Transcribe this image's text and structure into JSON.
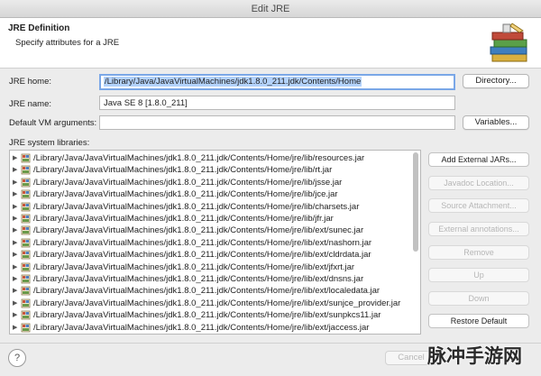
{
  "window": {
    "title": "Edit JRE"
  },
  "header": {
    "title": "JRE Definition",
    "description": "Specify attributes for a JRE",
    "banner_icon": "books-banner-icon"
  },
  "form": {
    "jre_home_label": "JRE home:",
    "jre_home_value": "/Library/Java/JavaVirtualMachines/jdk1.8.0_211.jdk/Contents/Home",
    "directory_button": "Directory...",
    "jre_name_label": "JRE name:",
    "jre_name_value": "Java SE 8 [1.8.0_211]",
    "vm_args_label": "Default VM arguments:",
    "vm_args_value": "",
    "variables_button": "Variables...",
    "libraries_label": "JRE system libraries:"
  },
  "libraries": [
    "/Library/Java/JavaVirtualMachines/jdk1.8.0_211.jdk/Contents/Home/jre/lib/resources.jar",
    "/Library/Java/JavaVirtualMachines/jdk1.8.0_211.jdk/Contents/Home/jre/lib/rt.jar",
    "/Library/Java/JavaVirtualMachines/jdk1.8.0_211.jdk/Contents/Home/jre/lib/jsse.jar",
    "/Library/Java/JavaVirtualMachines/jdk1.8.0_211.jdk/Contents/Home/jre/lib/jce.jar",
    "/Library/Java/JavaVirtualMachines/jdk1.8.0_211.jdk/Contents/Home/jre/lib/charsets.jar",
    "/Library/Java/JavaVirtualMachines/jdk1.8.0_211.jdk/Contents/Home/jre/lib/jfr.jar",
    "/Library/Java/JavaVirtualMachines/jdk1.8.0_211.jdk/Contents/Home/jre/lib/ext/sunec.jar",
    "/Library/Java/JavaVirtualMachines/jdk1.8.0_211.jdk/Contents/Home/jre/lib/ext/nashorn.jar",
    "/Library/Java/JavaVirtualMachines/jdk1.8.0_211.jdk/Contents/Home/jre/lib/ext/cldrdata.jar",
    "/Library/Java/JavaVirtualMachines/jdk1.8.0_211.jdk/Contents/Home/jre/lib/ext/jfxrt.jar",
    "/Library/Java/JavaVirtualMachines/jdk1.8.0_211.jdk/Contents/Home/jre/lib/ext/dnsns.jar",
    "/Library/Java/JavaVirtualMachines/jdk1.8.0_211.jdk/Contents/Home/jre/lib/ext/localedata.jar",
    "/Library/Java/JavaVirtualMachines/jdk1.8.0_211.jdk/Contents/Home/jre/lib/ext/sunjce_provider.jar",
    "/Library/Java/JavaVirtualMachines/jdk1.8.0_211.jdk/Contents/Home/jre/lib/ext/sunpkcs11.jar",
    "/Library/Java/JavaVirtualMachines/jdk1.8.0_211.jdk/Contents/Home/jre/lib/ext/jaccess.jar"
  ],
  "side_buttons": {
    "add_external_jars": "Add External JARs...",
    "javadoc_location": "Javadoc Location...",
    "source_attachment": "Source Attachment...",
    "external_annotations": "External annotations...",
    "remove": "Remove",
    "up": "Up",
    "down": "Down",
    "restore_default": "Restore Default"
  },
  "footer": {
    "help": "?",
    "cancel": "Cancel"
  },
  "watermark": "脉冲手游网",
  "colors": {
    "focus_ring": "#7aa7e7",
    "selection": "#b3d2fb"
  }
}
